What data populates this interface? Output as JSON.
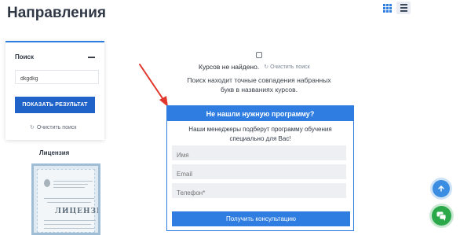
{
  "page": {
    "title": "Направления"
  },
  "view_toggle": {
    "active": "list",
    "grid_icon": "grid-icon",
    "list_icon": "list-icon"
  },
  "filter": {
    "heading": "Поиск",
    "collapse_icon": "minus-icon",
    "search_value": "dkgdkg",
    "show_button": "ПОКАЗАТЬ РЕЗУЛЬТАТ",
    "clear_label": "Очистить поиск"
  },
  "license": {
    "title": "Лицензия",
    "image_word": "ЛИЦЕНЗИЯ"
  },
  "results": {
    "not_found": "Курсов не найдено.",
    "clear_label": "Очистить поиск",
    "hint": "Поиск находит точные совпадения набранных букв в названиях курсов."
  },
  "consult_form": {
    "title": "Не нашли нужную программу?",
    "subtitle": "Наши менеджеры подберут программу обучения специально для Вас!",
    "fields": [
      {
        "placeholder": "Имя"
      },
      {
        "placeholder": "Email"
      },
      {
        "placeholder": "Телефон*"
      }
    ],
    "submit_label": "Получить консультацию"
  },
  "floating": {
    "up_icon": "arrow-up-icon",
    "chat_icon": "chat-icon"
  },
  "colors": {
    "accent": "#2f7de1",
    "button_dark": "#1f63c8",
    "chat_green": "#2aa84a",
    "arrow_red": "#e0362c"
  }
}
